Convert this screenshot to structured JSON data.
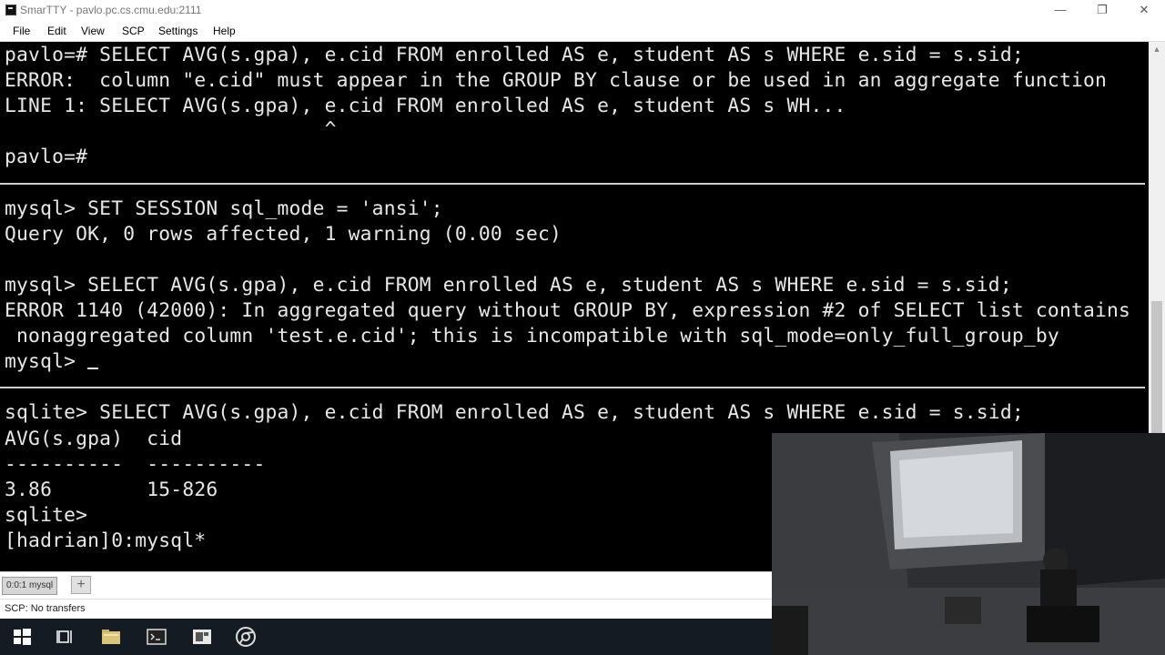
{
  "window": {
    "title": "SmarTTY - pavlo.pc.cs.cmu.edu:2111",
    "minimize": "—",
    "maximize": "❐",
    "close": "✕"
  },
  "menu": [
    "File",
    "Edit",
    "View",
    "SCP",
    "Settings",
    "Help"
  ],
  "terminal": {
    "postgres": [
      "pavlo=# SELECT AVG(s.gpa), e.cid FROM enrolled AS e, student AS s WHERE e.sid = s.sid;",
      "ERROR:  column \"e.cid\" must appear in the GROUP BY clause or be used in an aggregate function",
      "LINE 1: SELECT AVG(s.gpa), e.cid FROM enrolled AS e, student AS s WH...",
      "                           ^",
      "",
      "pavlo=#"
    ],
    "mysql": [
      "mysql> SET SESSION sql_mode = 'ansi';",
      "Query OK, 0 rows affected, 1 warning (0.00 sec)",
      "",
      "mysql> SELECT AVG(s.gpa), e.cid FROM enrolled AS e, student AS s WHERE e.sid = s.sid;",
      "ERROR 1140 (42000): In aggregated query without GROUP BY, expression #2 of SELECT list contains",
      " nonaggregated column 'test.e.cid'; this is incompatible with sql_mode=only_full_group_by",
      "mysql> "
    ],
    "sqlite": [
      "sqlite> SELECT AVG(s.gpa), e.cid FROM enrolled AS e, student AS s WHERE e.sid = s.sid;",
      "AVG(s.gpa)  cid",
      "----------  ----------",
      "3.86        15-826",
      "sqlite>"
    ],
    "tmux_status": "[hadrian]0:mysql*"
  },
  "tabs": {
    "active_label": "0:0:1 mysql",
    "add_label": "+"
  },
  "status": {
    "text": "SCP: No transfers"
  },
  "taskbar_icons": [
    "windows-start-icon",
    "task-view-icon",
    "file-explorer-icon",
    "terminal-icon",
    "remote-desktop-icon",
    "chrome-icon"
  ],
  "colors": {
    "terminal_bg": "#000000",
    "terminal_fg": "#e8e8e8",
    "taskbar_bg": "#151b22"
  }
}
